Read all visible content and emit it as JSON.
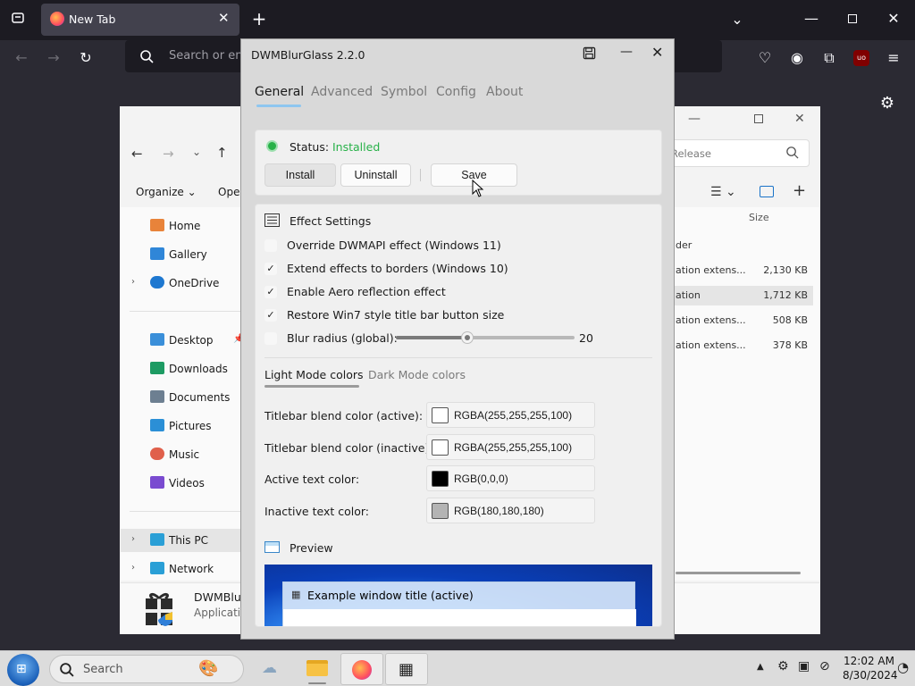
{
  "browser": {
    "tab_title": "New Tab",
    "url_placeholder": "Search or ent"
  },
  "explorer": {
    "toolbar": {
      "organize": "Organize",
      "open": "Oper"
    },
    "search_placeholder": "Release",
    "column_size": "Size",
    "nav": [
      {
        "label": "Home"
      },
      {
        "label": "Gallery"
      },
      {
        "label": "OneDrive"
      },
      {
        "label": "Desktop"
      },
      {
        "label": "Downloads"
      },
      {
        "label": "Documents"
      },
      {
        "label": "Pictures"
      },
      {
        "label": "Music"
      },
      {
        "label": "Videos"
      },
      {
        "label": "This PC"
      },
      {
        "label": "Network"
      }
    ],
    "rows": [
      {
        "name": "der",
        "size": ""
      },
      {
        "name": "ation extens...",
        "size": "2,130 KB"
      },
      {
        "name": "ation",
        "size": "1,712 KB"
      },
      {
        "name": "ation extens...",
        "size": "508 KB"
      },
      {
        "name": "ation extens...",
        "size": "378 KB"
      }
    ],
    "status": {
      "name": "DWMBlur",
      "type": "Applicatio"
    }
  },
  "dwm": {
    "title": "DWMBlurGlass 2.2.0",
    "tabs": [
      "General",
      "Advanced",
      "Symbol",
      "Config",
      "About"
    ],
    "status_label": "Status:",
    "status_value": "Installed",
    "status_color": "#27b148",
    "buttons": {
      "install": "Install",
      "uninstall": "Uninstall",
      "save": "Save"
    },
    "effect_settings": {
      "heading": "Effect Settings",
      "options": [
        {
          "label": "Override DWMAPI effect (Windows 11)",
          "checked": false
        },
        {
          "label": "Extend effects to borders (Windows 10)",
          "checked": true
        },
        {
          "label": "Enable Aero reflection effect",
          "checked": true
        },
        {
          "label": "Restore Win7 style title bar button size",
          "checked": true
        }
      ],
      "blur_label": "Blur radius (global):",
      "blur_value": "20",
      "blur_fraction": 0.4
    },
    "color_tabs": [
      "Light Mode colors",
      "Dark Mode colors"
    ],
    "colors": [
      {
        "label": "Titlebar blend color (active):",
        "value": "RGBA(255,255,255,100)",
        "swatch": "#ffffff"
      },
      {
        "label": "Titlebar blend color (inactive):",
        "value": "RGBA(255,255,255,100)",
        "swatch": "#ffffff"
      },
      {
        "label": "Active text color:",
        "value": "RGB(0,0,0)",
        "swatch": "#000000"
      },
      {
        "label": "Inactive text color:",
        "value": "RGB(180,180,180)",
        "swatch": "#b4b4b4"
      }
    ],
    "preview": {
      "heading": "Preview",
      "window_title": "Example window title (active)"
    }
  },
  "taskbar": {
    "search_placeholder": "Search",
    "time": "12:02 AM",
    "date": "8/30/2024"
  }
}
